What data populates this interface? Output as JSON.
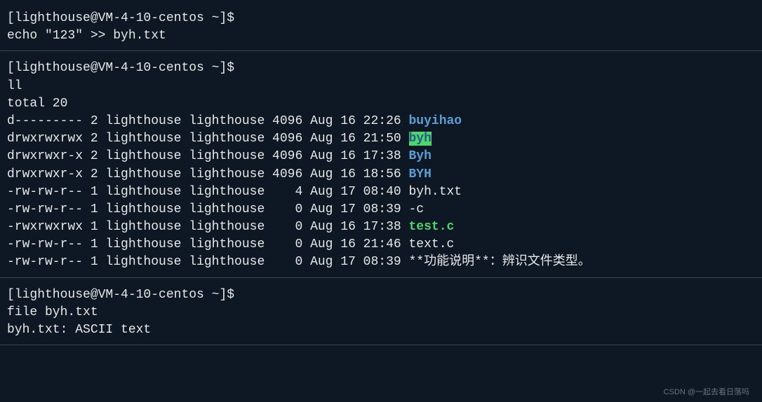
{
  "blocks": {
    "b1": {
      "prompt": "[lighthouse@VM-4-10-centos ~]$",
      "command": "echo \"123\" >> byh.txt"
    },
    "b2": {
      "prompt": "[lighthouse@VM-4-10-centos ~]$",
      "command": "ll",
      "total_line": "total 20",
      "rows": [
        {
          "perms_etc": "d--------- 2 lighthouse lighthouse 4096 Aug 16 22:26 ",
          "name": "buyihao",
          "cls": "dir-blue",
          "suffix": ""
        },
        {
          "perms_etc": "drwxrwxrwx 2 lighthouse lighthouse 4096 Aug 16 21:50 ",
          "name": "byh",
          "cls": "dir-blue-bg",
          "suffix": ""
        },
        {
          "perms_etc": "drwxrwxr-x 2 lighthouse lighthouse 4096 Aug 16 17:38 ",
          "name": "Byh",
          "cls": "dir-blue",
          "suffix": ""
        },
        {
          "perms_etc": "drwxrwxr-x 2 lighthouse lighthouse 4096 Aug 16 18:56 ",
          "name": "BYH",
          "cls": "dir-blue",
          "suffix": ""
        },
        {
          "perms_etc": "-rw-rw-r-- 1 lighthouse lighthouse    4 Aug 17 08:40 ",
          "name": "byh.txt",
          "cls": "",
          "suffix": ""
        },
        {
          "perms_etc": "-rw-rw-r-- 1 lighthouse lighthouse    0 Aug 17 08:39 ",
          "name": "-c",
          "cls": "",
          "suffix": ""
        },
        {
          "perms_etc": "-rwxrwxrwx 1 lighthouse lighthouse    0 Aug 16 17:38 ",
          "name": "test.c",
          "cls": "exec-green",
          "suffix": ""
        },
        {
          "perms_etc": "-rw-rw-r-- 1 lighthouse lighthouse    0 Aug 16 21:46 ",
          "name": "text.c",
          "cls": "",
          "suffix": ""
        },
        {
          "perms_etc": "-rw-rw-r-- 1 lighthouse lighthouse    0 Aug 17 08:39 ",
          "name": "**功能说明**：辨识文件类型。",
          "cls": "",
          "suffix": ""
        }
      ]
    },
    "b3": {
      "prompt": "[lighthouse@VM-4-10-centos ~]$",
      "command": "file byh.txt",
      "output": "byh.txt: ASCII text"
    }
  },
  "watermark": "CSDN @一起去看日落吗"
}
